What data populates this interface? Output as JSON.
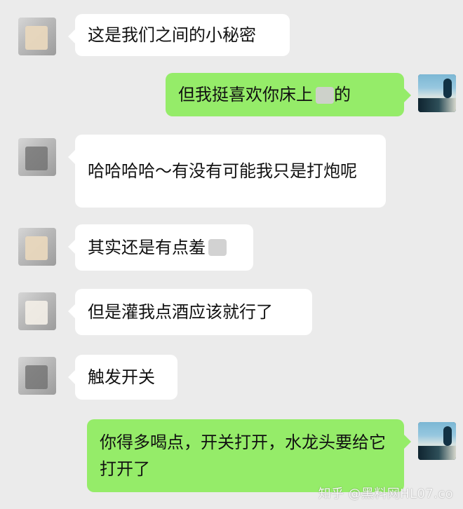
{
  "messages": [
    {
      "side": "left",
      "text": "这是我们之间的小秘密",
      "avatar": "avatar-other"
    },
    {
      "side": "right",
      "text": "但我挺喜欢你床上",
      "tail": "的",
      "avatar": "avatar-self"
    },
    {
      "side": "left",
      "text": "哈哈哈哈～有没有可能我只是打炮呢",
      "avatar": "avatar-other"
    },
    {
      "side": "left",
      "text": "其实还是有点羞",
      "avatar": "avatar-other"
    },
    {
      "side": "left",
      "text": "但是灌我点酒应该就行了",
      "avatar": "avatar-other"
    },
    {
      "side": "left",
      "text": "触发开关",
      "avatar": "avatar-other"
    },
    {
      "side": "right",
      "text": "你得多喝点，开关打开，水龙头要给它打开了",
      "avatar": "avatar-self"
    }
  ],
  "watermark": "知乎 @黑料网HL07.co",
  "colors": {
    "background": "#ebebeb",
    "incoming_bubble": "#ffffff",
    "outgoing_bubble": "#95ec69"
  }
}
